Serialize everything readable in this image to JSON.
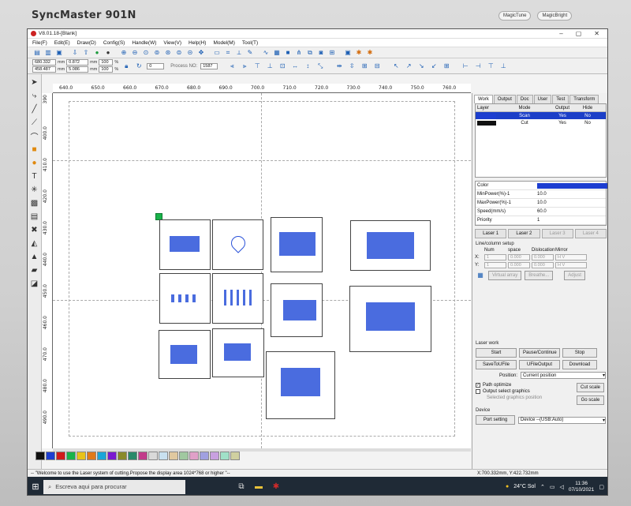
{
  "monitor": {
    "brand": "SyncMaster 901N",
    "logos": [
      "MagicTune",
      "MagicBright"
    ]
  },
  "app": {
    "title": "V8.01.18-[Blank]"
  },
  "menu": [
    "File(F)",
    "Edit(E)",
    "Draw(D)",
    "Config(S)",
    "Handle(W)",
    "View(V)",
    "Help(H)",
    "Model(M)",
    "Tool(T)"
  ],
  "toolbar2": {
    "x_val": "680.332",
    "y_val": "458.487",
    "w_val": "0.872",
    "h_val": "5.086",
    "unit": "mm",
    "sx": "100",
    "sy": "100",
    "pct": "%",
    "angle": "0",
    "process_no_label": "Process NO:",
    "process_no": "1587"
  },
  "hruler": [
    "640.0",
    "650.0",
    "660.0",
    "670.0",
    "680.0",
    "690.0",
    "700.0",
    "710.0",
    "720.0",
    "730.0",
    "740.0",
    "750.0",
    "760.0"
  ],
  "vruler": [
    "390",
    "400.0",
    "410.0",
    "420.0",
    "430.0",
    "440.0",
    "450.0",
    "460.0",
    "470.0",
    "480.0",
    "490.0"
  ],
  "palette": [
    "#111111",
    "#1d3ed1",
    "#d11a1a",
    "#19b34a",
    "#e8c21a",
    "#e07a1a",
    "#1aa6d9",
    "#7a1ad1",
    "#8a8a2a",
    "#2a8a6a",
    "#c23a8a",
    "#d9d9d9",
    "#c8e0f0",
    "#e0c8a0",
    "#a0c8a0",
    "#e0a0c8",
    "#a0a0e0",
    "#c8a0e0",
    "#a0e0c8",
    "#d0d0a0"
  ],
  "right_tabs": [
    "Work",
    "Output",
    "Doc",
    "User",
    "Test",
    "Transform"
  ],
  "layer_table": {
    "headers": [
      "Layer",
      "Mode",
      "Output",
      "Hide"
    ],
    "rows": [
      {
        "color": "#1d3ed1",
        "mode": "Scan",
        "output": "Yes",
        "hide": "No"
      },
      {
        "color": "#111111",
        "mode": "Cut",
        "output": "Yes",
        "hide": "No"
      }
    ]
  },
  "props": [
    {
      "label": "Color",
      "value": ""
    },
    {
      "label": "MinPower(%)-1",
      "value": "10.0"
    },
    {
      "label": "MaxPower(%)-1",
      "value": "10.0"
    },
    {
      "label": "Speed(mm/s)",
      "value": "60.0"
    },
    {
      "label": "Priority",
      "value": "1"
    }
  ],
  "laser_tabs": [
    {
      "label": "Laser 1",
      "enabled": true
    },
    {
      "label": "Laser 2",
      "enabled": true
    },
    {
      "label": "Laser 3",
      "enabled": false
    },
    {
      "label": "Laser 4",
      "enabled": false
    }
  ],
  "array": {
    "title": "Line/column setup",
    "headers": [
      "Num",
      "space",
      "Dislocation",
      "Mirror"
    ],
    "x": {
      "num": "1",
      "space": "0.000",
      "dis": "0.000"
    },
    "y": {
      "num": "1",
      "space": "0.000",
      "dis": "0.000"
    },
    "buttons": [
      "Virtual array",
      "Breathe...",
      "Adjust"
    ]
  },
  "laser_work": {
    "title": "Laser work",
    "buttons": [
      "Start",
      "Pause/Continue",
      "Stop",
      "SaveToUFile",
      "UFileOutput",
      "Download"
    ],
    "position_label": "Position:",
    "position_value": "Current position",
    "path_optimize": "Path optimize",
    "output_select": "Output select graphics",
    "selected_pos": "Selected graphics position",
    "cut_scale": "Cut scale",
    "go_scale": "Go scale"
  },
  "device": {
    "title": "Device",
    "port_button": "Port setting",
    "select": "Device --(USB:Auto)"
  },
  "status": {
    "message": "-- \"Welcome to use the Laser system of cutting.Propose the display area 1024*768 or higher \"--",
    "coords": "X:700.332mm, Y:422.732mm"
  },
  "taskbar": {
    "search": "Escreva aqui para procurar",
    "weather": "24°C  Sol",
    "time": "11:36",
    "date": "07/10/2021"
  }
}
